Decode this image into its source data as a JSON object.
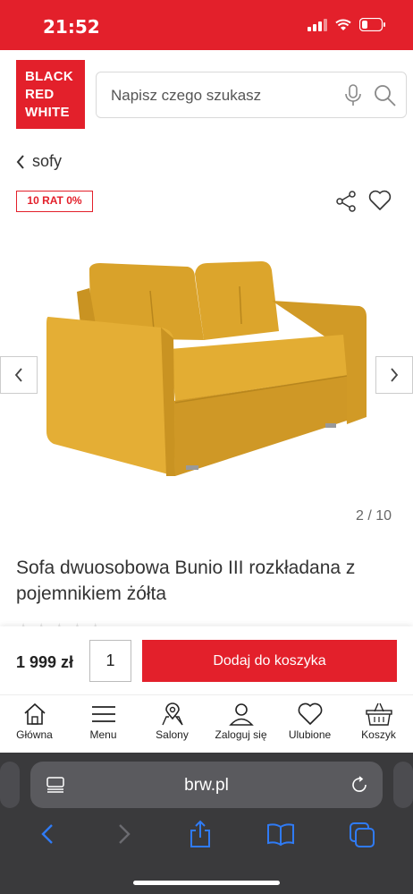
{
  "status": {
    "time": "21:52"
  },
  "header": {
    "logo_lines": [
      "BLACK",
      "RED",
      "WHITE"
    ],
    "search_placeholder": "Napisz czego szukasz"
  },
  "breadcrumb": {
    "label": "sofy"
  },
  "product": {
    "installments_badge": "10 RAT 0%",
    "image_counter": "2 / 10",
    "title": "Sofa dwuosobowa Bunio III rozkładana z pojemnikiem żółta",
    "price": "1 999 zł",
    "quantity": "1",
    "add_to_cart": "Dodaj do koszyka",
    "color": "#e0a82e"
  },
  "bottom_nav": [
    {
      "icon": "home-icon",
      "label": "Główna"
    },
    {
      "icon": "menu-icon",
      "label": "Menu"
    },
    {
      "icon": "map-pin-icon",
      "label": "Salony"
    },
    {
      "icon": "user-icon",
      "label": "Zaloguj się"
    },
    {
      "icon": "heart-icon",
      "label": "Ulubione"
    },
    {
      "icon": "basket-icon",
      "label": "Koszyk"
    }
  ],
  "browser": {
    "url": "brw.pl"
  },
  "colors": {
    "brand": "#e3202b",
    "browser_bg": "#3a3a3c",
    "browser_accent": "#2f7bf6"
  }
}
